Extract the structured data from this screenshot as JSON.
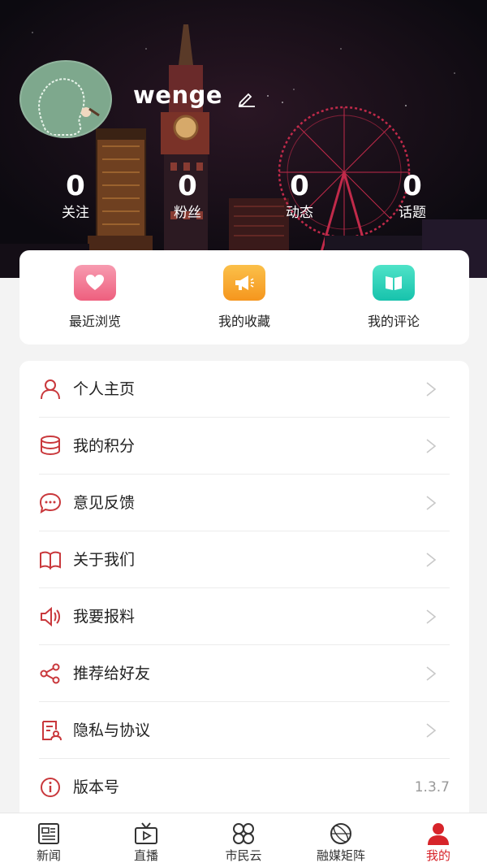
{
  "profile": {
    "username": "wenge",
    "stats": [
      {
        "value": "0",
        "label": "关注"
      },
      {
        "value": "0",
        "label": "粉丝"
      },
      {
        "value": "0",
        "label": "动态"
      },
      {
        "value": "0",
        "label": "话题"
      }
    ]
  },
  "quick_actions": [
    {
      "label": "最近浏览",
      "icon": "heart-icon",
      "color": "#f06b86"
    },
    {
      "label": "我的收藏",
      "icon": "megaphone-icon",
      "color": "#f7a531"
    },
    {
      "label": "我的评论",
      "icon": "book-icon",
      "color": "#23cdb4"
    }
  ],
  "menu": {
    "items": [
      {
        "label": "个人主页",
        "icon": "user-icon"
      },
      {
        "label": "我的积分",
        "icon": "coins-icon"
      },
      {
        "label": "意见反馈",
        "icon": "chat-bubble-icon"
      },
      {
        "label": "关于我们",
        "icon": "open-book-icon"
      },
      {
        "label": "我要报料",
        "icon": "speaker-icon"
      },
      {
        "label": "推荐给好友",
        "icon": "share-icon"
      },
      {
        "label": "隐私与协议",
        "icon": "document-icon"
      },
      {
        "label": "版本号",
        "icon": "info-icon",
        "value": "1.3.7"
      }
    ]
  },
  "bottom_nav": {
    "items": [
      {
        "label": "新闻",
        "icon": "news-icon"
      },
      {
        "label": "直播",
        "icon": "tv-icon"
      },
      {
        "label": "市民云",
        "icon": "grid-icon"
      },
      {
        "label": "融媒矩阵",
        "icon": "globe-icon"
      },
      {
        "label": "我的",
        "icon": "person-icon"
      }
    ],
    "active_index": 4
  },
  "colors": {
    "accent": "#d7242a",
    "menu_icon": "#c9383c"
  }
}
